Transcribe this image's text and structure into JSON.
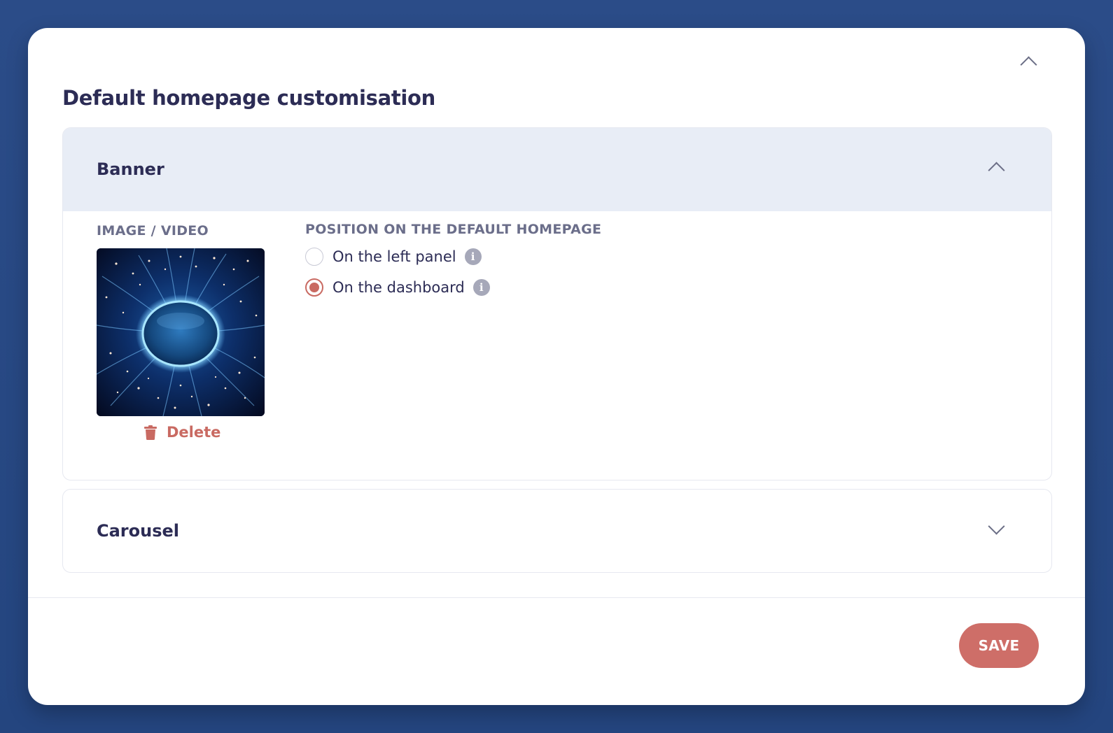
{
  "card": {
    "title": "Default homepage customisation"
  },
  "banner": {
    "title": "Banner",
    "expanded": true,
    "media_label": "IMAGE / VIDEO",
    "delete_label": "Delete",
    "position_label": "POSITION ON THE DEFAULT HOMEPAGE",
    "options": [
      {
        "label": "On the left panel",
        "selected": false
      },
      {
        "label": "On the dashboard",
        "selected": true
      }
    ]
  },
  "carousel": {
    "title": "Carousel",
    "expanded": false
  },
  "footer": {
    "save_label": "SAVE"
  },
  "icons": {
    "card_collapse": "chevron-up-icon",
    "banner_toggle": "chevron-up-icon",
    "carousel_toggle": "chevron-down-icon",
    "delete": "trash-icon",
    "info": "info-icon"
  },
  "colors": {
    "page_background": "#2b4c88",
    "card_background": "#ffffff",
    "heading_text": "#2c2c55",
    "muted_label": "#6b6e8a",
    "panel_header_background": "#e8edf6",
    "accent": "#ce6e68",
    "info_icon": "#a6a8b9"
  }
}
